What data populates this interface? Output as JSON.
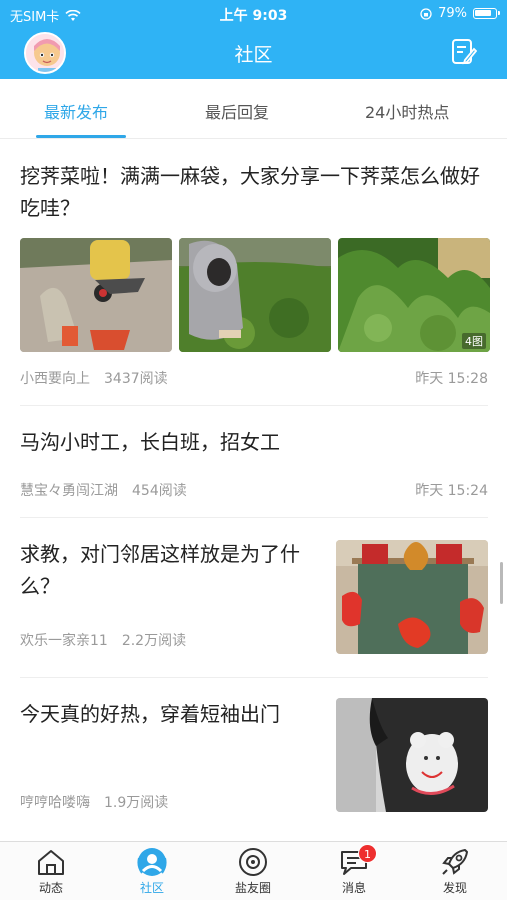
{
  "status_bar": {
    "carrier": "无SIM卡",
    "time": "上午 9:03",
    "battery": "79%"
  },
  "header": {
    "title": "社区"
  },
  "tabs": [
    {
      "label": "最新发布",
      "active": true
    },
    {
      "label": "最后回复",
      "active": false
    },
    {
      "label": "24小时热点",
      "active": false
    }
  ],
  "posts": [
    {
      "title": "挖荠菜啦！满满一麻袋，大家分享一下荠菜怎么做好吃哇？",
      "author": "小西要向上",
      "reads": "3437阅读",
      "time": "昨天 15:28",
      "image_count": "4图"
    },
    {
      "title": "马沟小时工，长白班，招女工",
      "author": "慧宝々勇闯江湖",
      "reads": "454阅读",
      "time": "昨天 15:24"
    },
    {
      "title": "求教，对门邻居这样放是为了什么？",
      "author": "欢乐一家亲11",
      "reads": "2.2万阅读"
    },
    {
      "title": "今天真的好热，穿着短袖出门",
      "author": "哼哼哈喽嗨",
      "reads": "1.9万阅读"
    }
  ],
  "bottom_nav": [
    {
      "label": "动态",
      "icon": "home-icon",
      "active": false
    },
    {
      "label": "社区",
      "icon": "community-icon",
      "active": true
    },
    {
      "label": "盐友圈",
      "icon": "circle-icon",
      "active": false
    },
    {
      "label": "消息",
      "icon": "message-icon",
      "active": false,
      "badge": "1"
    },
    {
      "label": "发现",
      "icon": "rocket-icon",
      "active": false
    }
  ],
  "colors": {
    "brand": "#2fb3f5",
    "accent": "#2fa7e8",
    "badge": "#ee2f2f"
  }
}
